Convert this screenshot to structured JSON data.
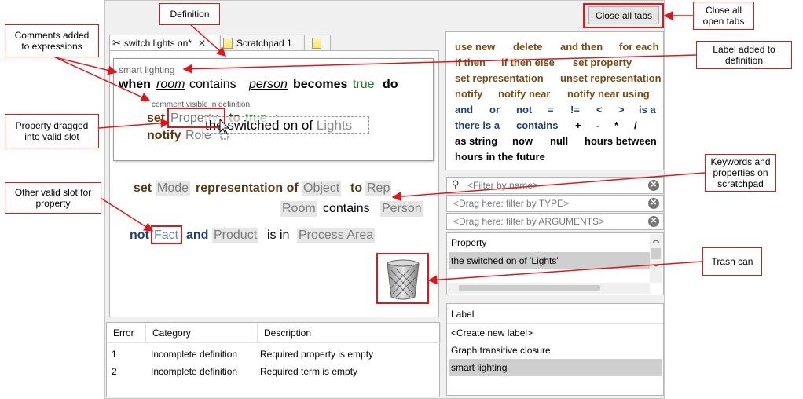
{
  "toolbar": {
    "close_all_label": "Close all tabs"
  },
  "tabs": [
    {
      "label": "switch lights on*",
      "close": "✕"
    },
    {
      "label": "Scratchpad 1"
    },
    {
      "label": ""
    }
  ],
  "definition": {
    "label_comment": "smart lighting",
    "when": "when",
    "room": "room",
    "contains": "contains",
    "person": "person",
    "becomes": "becomes",
    "true1": "true",
    "do": "do",
    "inner_comment": "comment visible in definition",
    "set": "set",
    "property_slot": "Property",
    "to": "to",
    "true2": "true",
    "colon": ";",
    "notify": "notify",
    "role_slot": "Role"
  },
  "drag_tooltip": {
    "the": "the",
    "switched_on_of": "switched on of",
    "lights": "Lights"
  },
  "scratchpad": {
    "set": "set",
    "mode": "Mode",
    "representation_of": "representation of",
    "object": "Object",
    "to": "to",
    "rep": "Rep",
    "room": "Room",
    "contains": "contains",
    "person": "Person",
    "not": "not",
    "fact": "Fact",
    "and": "and",
    "product": "Product",
    "is_in": "is in",
    "process_area": "Process Area"
  },
  "errors": {
    "headers": [
      "Error",
      "Category",
      "Description"
    ],
    "rows": [
      {
        "num": "1",
        "category": "Incomplete definition",
        "description": "Required property is empty"
      },
      {
        "num": "2",
        "category": "Incomplete definition",
        "description": "Required term is empty"
      }
    ]
  },
  "keywords": {
    "use_new": "use new",
    "delete": "delete",
    "and_then": "and then",
    "for_each": "for each",
    "if_then": "if then",
    "if_then_else": "if then else",
    "set_property": "set property",
    "set_representation": "set representation",
    "unset_representation": "unset representation",
    "notify": "notify",
    "notify_near": "notify near",
    "notify_near_using": "notify near using",
    "and": "and",
    "or": "or",
    "not": "not",
    "eq": "=",
    "neq": "!=",
    "lt": "<",
    "gt": ">",
    "is_a": "is a",
    "there_is_a": "there is a",
    "contains": "contains",
    "plus": "+",
    "minus": "-",
    "times": "*",
    "div": "/",
    "as_string": "as string",
    "now": "now",
    "null": "null",
    "hours_between": "hours between",
    "hours_in_future": "hours in the future"
  },
  "filters": {
    "name_placeholder": "<Filter by name>",
    "type_placeholder": "<Drag here: filter by TYPE>",
    "args_placeholder": "<Drag here: filter by ARGUMENTS>"
  },
  "property_list": {
    "header": "Property",
    "items": [
      "the switched on of 'Lights'"
    ]
  },
  "label_list": {
    "header": "Label",
    "items": [
      "<Create new label>",
      "Graph transitive closure",
      "smart lighting"
    ]
  },
  "annotations": {
    "definition": "Definition",
    "close_all": "Close all\nopen tabs",
    "comments": "Comments added\nto expressions",
    "label_added": "Label added to\ndefinition",
    "property_dragged": "Property dragged\ninto valid slot",
    "keywords_props": "Keywords and\nproperties on\nscratchpad",
    "other_slot": "Other valid slot for\nproperty",
    "trash": "Trash can"
  },
  "colors": {
    "annotation_red": "#e0161b",
    "keyword_brown": "#7a4a12",
    "keyword_blue": "#1f3f74",
    "selection_gray": "#cfcfcf"
  }
}
